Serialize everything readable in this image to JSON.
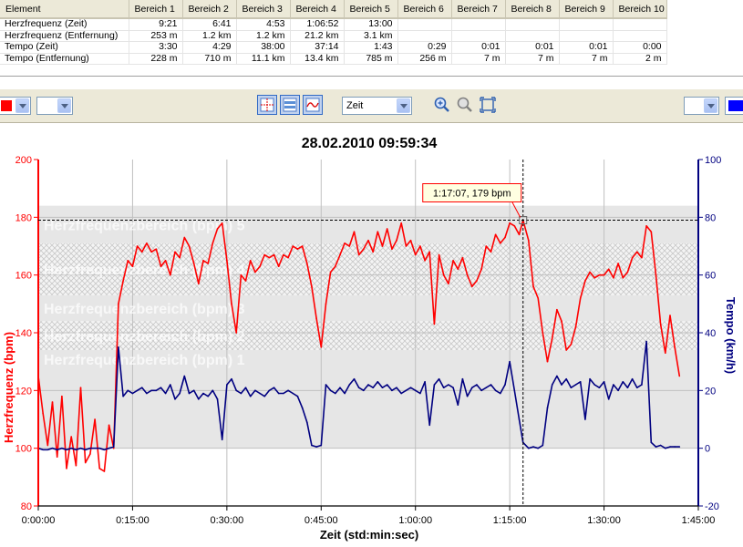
{
  "table": {
    "headers": [
      "Element",
      "Bereich 1",
      "Bereich 2",
      "Bereich 3",
      "Bereich 4",
      "Bereich 5",
      "Bereich 6",
      "Bereich 7",
      "Bereich 8",
      "Bereich 9",
      "Bereich 10"
    ],
    "rows": [
      {
        "label": "Herzfrequenz (Zeit)",
        "cells": [
          "9:21",
          "6:41",
          "4:53",
          "1:06:52",
          "13:00",
          "",
          "",
          "",
          "",
          ""
        ]
      },
      {
        "label": "Herzfrequenz (Entfernung)",
        "cells": [
          "253 m",
          "1.2 km",
          "1.2 km",
          "21.2 km",
          "3.1 km",
          "",
          "",
          "",
          "",
          ""
        ]
      },
      {
        "label": "Tempo (Zeit)",
        "cells": [
          "3:30",
          "4:29",
          "38:00",
          "37:14",
          "1:43",
          "0:29",
          "0:01",
          "0:01",
          "0:01",
          "0:00"
        ]
      },
      {
        "label": "Tempo (Entfernung)",
        "cells": [
          "228 m",
          "710 m",
          "11.1 km",
          "13.4 km",
          "785 m",
          "256 m",
          "7 m",
          "7 m",
          "7 m",
          "2 m"
        ]
      }
    ]
  },
  "toolbar": {
    "xaxis_select": "Zeit",
    "left_swatch_color": "#ff0000",
    "right_swatch_color": "#0000ff",
    "icons": [
      "crosshair-icon",
      "zones-icon",
      "smoothing-icon",
      "zoom-in-icon",
      "zoom-out-icon",
      "fit-icon"
    ]
  },
  "chart_data": {
    "type": "line",
    "title": "28.02.2010 09:59:34",
    "xlabel": "Zeit (std:min:sec)",
    "ylabel_left": "Herzfrequenz (bpm)",
    "ylabel_right": "Tempo (km/h)",
    "xlim": [
      0,
      6300
    ],
    "ylim_left": [
      80,
      200
    ],
    "ylim_right": [
      -20,
      100
    ],
    "x_ticks": [
      0,
      900,
      1800,
      2700,
      3600,
      4500,
      5400,
      6300
    ],
    "x_tick_labels": [
      "0:00:00",
      "0:15:00",
      "0:30:00",
      "0:45:00",
      "1:00:00",
      "1:15:00",
      "1:30:00",
      "1:45:00"
    ],
    "y_ticks_left": [
      "80",
      "100",
      "120",
      "140",
      "160",
      "180",
      "200"
    ],
    "y_ticks_right": [
      "-20",
      "0",
      "20",
      "40",
      "60",
      "80",
      "100"
    ],
    "grid": true,
    "zones": [
      {
        "label": "Herzfrequenzbereich (bpm) 5",
        "low": 171,
        "high": 184
      },
      {
        "label": "Herzfrequenzbereich (bpm) 4",
        "low": 153,
        "high": 171
      },
      {
        "label": "Herzfrequenzbereich (bpm) 3",
        "low": 144,
        "high": 153
      },
      {
        "label": "Herzfrequenzbereich (bpm) 2",
        "low": 134,
        "high": 144
      },
      {
        "label": "Herzfrequenzbereich (bpm) 1",
        "low": 100,
        "high": 134
      }
    ],
    "cursor": {
      "x": 4627,
      "y": 179,
      "label": "1:17:07, 179 bpm"
    },
    "colors": {
      "heart_rate": "#ff0000",
      "tempo": "#000080"
    },
    "series": [
      {
        "name": "Herzfrequenz",
        "axis": "left",
        "points": [
          [
            0,
            125
          ],
          [
            45,
            112
          ],
          [
            90,
            101
          ],
          [
            135,
            116
          ],
          [
            180,
            97
          ],
          [
            225,
            118
          ],
          [
            270,
            93
          ],
          [
            315,
            104
          ],
          [
            360,
            94
          ],
          [
            405,
            121
          ],
          [
            450,
            95
          ],
          [
            495,
            98
          ],
          [
            540,
            110
          ],
          [
            585,
            93
          ],
          [
            630,
            92
          ],
          [
            675,
            108
          ],
          [
            720,
            100
          ],
          [
            765,
            150
          ],
          [
            810,
            158
          ],
          [
            855,
            165
          ],
          [
            900,
            163
          ],
          [
            945,
            170
          ],
          [
            990,
            168
          ],
          [
            1035,
            171
          ],
          [
            1080,
            168
          ],
          [
            1125,
            169
          ],
          [
            1170,
            163
          ],
          [
            1215,
            165
          ],
          [
            1260,
            160
          ],
          [
            1305,
            168
          ],
          [
            1350,
            166
          ],
          [
            1395,
            173
          ],
          [
            1440,
            170
          ],
          [
            1485,
            164
          ],
          [
            1530,
            157
          ],
          [
            1575,
            165
          ],
          [
            1620,
            164
          ],
          [
            1665,
            171
          ],
          [
            1710,
            176
          ],
          [
            1755,
            178
          ],
          [
            1800,
            165
          ],
          [
            1845,
            150
          ],
          [
            1890,
            140
          ],
          [
            1935,
            160
          ],
          [
            1980,
            158
          ],
          [
            2025,
            165
          ],
          [
            2070,
            161
          ],
          [
            2115,
            163
          ],
          [
            2160,
            167
          ],
          [
            2205,
            166
          ],
          [
            2250,
            167
          ],
          [
            2295,
            163
          ],
          [
            2340,
            167
          ],
          [
            2385,
            166
          ],
          [
            2430,
            170
          ],
          [
            2475,
            169
          ],
          [
            2520,
            170
          ],
          [
            2565,
            164
          ],
          [
            2610,
            156
          ],
          [
            2655,
            145
          ],
          [
            2700,
            135
          ],
          [
            2745,
            150
          ],
          [
            2790,
            161
          ],
          [
            2835,
            163
          ],
          [
            2880,
            167
          ],
          [
            2925,
            171
          ],
          [
            2970,
            170
          ],
          [
            3015,
            175
          ],
          [
            3060,
            167
          ],
          [
            3105,
            169
          ],
          [
            3150,
            172
          ],
          [
            3195,
            168
          ],
          [
            3240,
            175
          ],
          [
            3285,
            170
          ],
          [
            3330,
            176
          ],
          [
            3375,
            169
          ],
          [
            3420,
            172
          ],
          [
            3465,
            178
          ],
          [
            3510,
            170
          ],
          [
            3555,
            172
          ],
          [
            3600,
            167
          ],
          [
            3645,
            170
          ],
          [
            3690,
            165
          ],
          [
            3735,
            168
          ],
          [
            3780,
            143
          ],
          [
            3825,
            167
          ],
          [
            3870,
            160
          ],
          [
            3915,
            157
          ],
          [
            3960,
            165
          ],
          [
            4005,
            162
          ],
          [
            4050,
            166
          ],
          [
            4095,
            160
          ],
          [
            4140,
            156
          ],
          [
            4185,
            158
          ],
          [
            4230,
            162
          ],
          [
            4275,
            170
          ],
          [
            4320,
            168
          ],
          [
            4365,
            174
          ],
          [
            4410,
            171
          ],
          [
            4455,
            173
          ],
          [
            4500,
            178
          ],
          [
            4545,
            177
          ],
          [
            4590,
            174
          ],
          [
            4627,
            179
          ],
          [
            4680,
            172
          ],
          [
            4725,
            156
          ],
          [
            4770,
            152
          ],
          [
            4815,
            140
          ],
          [
            4860,
            130
          ],
          [
            4905,
            138
          ],
          [
            4950,
            148
          ],
          [
            4995,
            144
          ],
          [
            5040,
            134
          ],
          [
            5085,
            136
          ],
          [
            5130,
            142
          ],
          [
            5175,
            152
          ],
          [
            5220,
            158
          ],
          [
            5265,
            161
          ],
          [
            5310,
            159
          ],
          [
            5355,
            160
          ],
          [
            5400,
            160
          ],
          [
            5445,
            162
          ],
          [
            5490,
            159
          ],
          [
            5535,
            164
          ],
          [
            5580,
            159
          ],
          [
            5625,
            161
          ],
          [
            5670,
            166
          ],
          [
            5715,
            168
          ],
          [
            5760,
            166
          ],
          [
            5805,
            177
          ],
          [
            5850,
            175
          ],
          [
            5895,
            160
          ],
          [
            5940,
            143
          ],
          [
            5985,
            133
          ],
          [
            6030,
            146
          ],
          [
            6075,
            135
          ],
          [
            6120,
            125
          ]
        ]
      },
      {
        "name": "Tempo",
        "axis": "right",
        "points": [
          [
            0,
            0
          ],
          [
            45,
            -0.5
          ],
          [
            90,
            -0.5
          ],
          [
            135,
            0
          ],
          [
            180,
            -0.5
          ],
          [
            225,
            0
          ],
          [
            270,
            -0.5
          ],
          [
            315,
            0
          ],
          [
            360,
            -0.5
          ],
          [
            405,
            0
          ],
          [
            450,
            -0.5
          ],
          [
            495,
            0
          ],
          [
            540,
            0
          ],
          [
            585,
            0
          ],
          [
            630,
            -0.5
          ],
          [
            675,
            0
          ],
          [
            720,
            0.5
          ],
          [
            765,
            35
          ],
          [
            810,
            18
          ],
          [
            855,
            20
          ],
          [
            900,
            19
          ],
          [
            945,
            20
          ],
          [
            990,
            21
          ],
          [
            1035,
            19
          ],
          [
            1080,
            20
          ],
          [
            1125,
            20
          ],
          [
            1170,
            21
          ],
          [
            1215,
            19
          ],
          [
            1260,
            22
          ],
          [
            1305,
            17
          ],
          [
            1350,
            19
          ],
          [
            1395,
            25
          ],
          [
            1440,
            19
          ],
          [
            1485,
            20
          ],
          [
            1530,
            17
          ],
          [
            1575,
            19
          ],
          [
            1620,
            18
          ],
          [
            1665,
            20
          ],
          [
            1710,
            17
          ],
          [
            1755,
            3
          ],
          [
            1800,
            22
          ],
          [
            1845,
            24
          ],
          [
            1890,
            20
          ],
          [
            1935,
            19
          ],
          [
            1980,
            21
          ],
          [
            2025,
            18
          ],
          [
            2070,
            20
          ],
          [
            2115,
            19
          ],
          [
            2160,
            18
          ],
          [
            2205,
            20
          ],
          [
            2250,
            21
          ],
          [
            2295,
            19
          ],
          [
            2340,
            19
          ],
          [
            2385,
            20
          ],
          [
            2430,
            19
          ],
          [
            2475,
            18
          ],
          [
            2520,
            14
          ],
          [
            2565,
            9
          ],
          [
            2610,
            1
          ],
          [
            2655,
            0.5
          ],
          [
            2700,
            1
          ],
          [
            2745,
            22
          ],
          [
            2790,
            20
          ],
          [
            2835,
            19
          ],
          [
            2880,
            21
          ],
          [
            2925,
            19
          ],
          [
            2970,
            22
          ],
          [
            3015,
            24
          ],
          [
            3060,
            21
          ],
          [
            3105,
            20
          ],
          [
            3150,
            22
          ],
          [
            3195,
            21
          ],
          [
            3240,
            23
          ],
          [
            3285,
            21
          ],
          [
            3330,
            22
          ],
          [
            3375,
            20
          ],
          [
            3420,
            21
          ],
          [
            3465,
            19
          ],
          [
            3510,
            20
          ],
          [
            3555,
            21
          ],
          [
            3600,
            20
          ],
          [
            3645,
            19
          ],
          [
            3690,
            23
          ],
          [
            3735,
            8
          ],
          [
            3780,
            22
          ],
          [
            3825,
            24
          ],
          [
            3870,
            21
          ],
          [
            3915,
            22
          ],
          [
            3960,
            21
          ],
          [
            4005,
            15
          ],
          [
            4050,
            24
          ],
          [
            4095,
            18
          ],
          [
            4140,
            21
          ],
          [
            4185,
            22
          ],
          [
            4230,
            20
          ],
          [
            4275,
            21
          ],
          [
            4320,
            22
          ],
          [
            4365,
            20
          ],
          [
            4410,
            19
          ],
          [
            4455,
            22
          ],
          [
            4500,
            30
          ],
          [
            4545,
            20
          ],
          [
            4590,
            10
          ],
          [
            4627,
            2
          ],
          [
            4680,
            0
          ],
          [
            4725,
            0.5
          ],
          [
            4770,
            0
          ],
          [
            4815,
            1
          ],
          [
            4860,
            14
          ],
          [
            4905,
            22
          ],
          [
            4950,
            25
          ],
          [
            4995,
            22
          ],
          [
            5040,
            24
          ],
          [
            5085,
            21
          ],
          [
            5130,
            22
          ],
          [
            5175,
            23
          ],
          [
            5220,
            10
          ],
          [
            5265,
            24
          ],
          [
            5310,
            22
          ],
          [
            5355,
            21
          ],
          [
            5400,
            23
          ],
          [
            5445,
            17
          ],
          [
            5490,
            22
          ],
          [
            5535,
            20
          ],
          [
            5580,
            23
          ],
          [
            5625,
            21
          ],
          [
            5670,
            24
          ],
          [
            5715,
            21
          ],
          [
            5760,
            22
          ],
          [
            5805,
            37
          ],
          [
            5850,
            2
          ],
          [
            5895,
            0.5
          ],
          [
            5940,
            1
          ],
          [
            5985,
            0
          ],
          [
            6030,
            0.5
          ],
          [
            6075,
            0.5
          ],
          [
            6120,
            0.5
          ]
        ]
      }
    ]
  }
}
